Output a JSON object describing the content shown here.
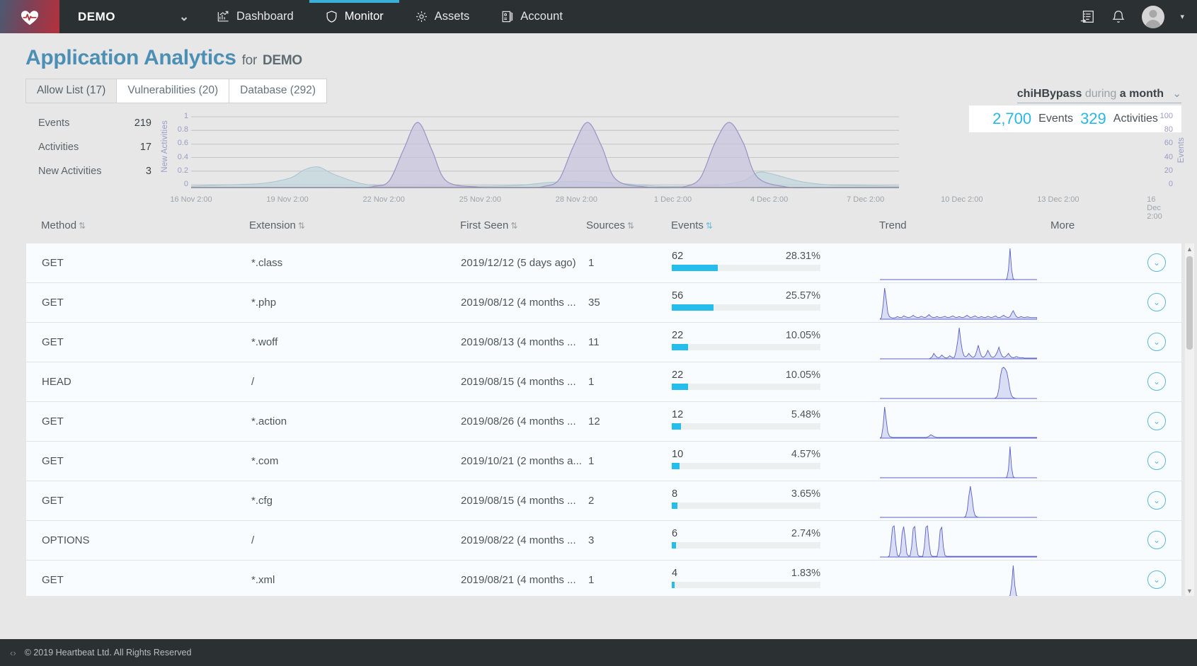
{
  "topnav": {
    "logo_icon": "heartbeat-logo-icon",
    "brand": "DEMO",
    "brand_caret": "⌄",
    "items": [
      {
        "label": "Dashboard",
        "icon": "chart-growth-icon",
        "active": false
      },
      {
        "label": "Monitor",
        "icon": "shield-icon",
        "active": true
      },
      {
        "label": "Assets",
        "icon": "gear-icon",
        "active": false
      },
      {
        "label": "Account",
        "icon": "id-card-icon",
        "active": false
      }
    ],
    "right_icons": [
      "task-list-icon",
      "bell-icon",
      "avatar"
    ],
    "avatar_caret": "▾"
  },
  "page": {
    "title": "Application Analytics",
    "title_for": "for",
    "title_demo": "DEMO"
  },
  "tabs": [
    {
      "label": "Allow List (17)",
      "active": true
    },
    {
      "label": "Vulnerabilities (20)",
      "active": false
    },
    {
      "label": "Database (292)",
      "active": false
    }
  ],
  "filter": {
    "query": "chiHBypass",
    "during": "during",
    "range": "a month",
    "caret": "⌄"
  },
  "summary": {
    "events_value": "2,700",
    "events_label": "Events",
    "activities_value": "329",
    "activities_label": "Activities"
  },
  "stats": [
    {
      "label": "Events",
      "value": "219"
    },
    {
      "label": "Activities",
      "value": "17"
    },
    {
      "label": "New Activities",
      "value": "3"
    }
  ],
  "chart_data": {
    "type": "area",
    "title": "",
    "xlabel": "",
    "ylabel": "New Activities",
    "ylabel_right": "Events",
    "ylim": [
      0,
      1
    ],
    "ylim_right": [
      0,
      100
    ],
    "yticks": [
      "1",
      "0.8",
      "0.6",
      "0.4",
      "0.2",
      "0"
    ],
    "yticks_right": [
      "100",
      "80",
      "60",
      "40",
      "20",
      "0"
    ],
    "xticks": [
      "16 Nov 2:00",
      "19 Nov 2:00",
      "22 Nov 2:00",
      "25 Nov 2:00",
      "28 Nov 2:00",
      "1 Dec 2:00",
      "4 Dec 2:00",
      "7 Dec 2:00",
      "10 Dec 2:00",
      "13 Dec 2:00",
      "16 Dec 2:00"
    ],
    "grid": true,
    "legend_position": "none",
    "series": [
      {
        "name": "New Activities",
        "color": "#9a93c4",
        "fill": "#c9c4de",
        "x": [
          0,
          4,
          8,
          12,
          16,
          20,
          24,
          26,
          28,
          30,
          32,
          34,
          36,
          40,
          44,
          48,
          50,
          52,
          54,
          56,
          58,
          60,
          64,
          68,
          70,
          72,
          74,
          76,
          78,
          80,
          84,
          88,
          92,
          96,
          100
        ],
        "values": [
          0,
          0,
          0,
          0,
          0,
          0,
          0,
          0.02,
          0.1,
          0.55,
          0.95,
          0.55,
          0.1,
          0.01,
          0,
          0,
          0.02,
          0.12,
          0.6,
          0.95,
          0.6,
          0.12,
          0.01,
          0,
          0.02,
          0.15,
          0.65,
          0.95,
          0.65,
          0.15,
          0.01,
          0,
          0,
          0,
          0
        ]
      },
      {
        "name": "Events",
        "color": "#a8c3cf",
        "fill": "#c2d7de",
        "x": [
          0,
          5,
          10,
          14,
          16,
          18,
          20,
          24,
          28,
          34,
          40,
          46,
          50,
          54,
          58,
          62,
          66,
          70,
          74,
          78,
          80,
          82,
          86,
          90,
          94,
          100
        ],
        "values": [
          2,
          4,
          6,
          14,
          26,
          30,
          20,
          6,
          2,
          2,
          2,
          3,
          7,
          9,
          8,
          5,
          2,
          2,
          3,
          10,
          22,
          20,
          9,
          4,
          3,
          2
        ]
      }
    ]
  },
  "table": {
    "columns": [
      {
        "label": "Method",
        "sort": "both"
      },
      {
        "label": "Extension",
        "sort": "both"
      },
      {
        "label": "First Seen",
        "sort": "both"
      },
      {
        "label": "Sources",
        "sort": "both"
      },
      {
        "label": "Events",
        "sort": "active"
      },
      {
        "label": "Trend",
        "sort": "none"
      },
      {
        "label": "More",
        "sort": "none"
      }
    ],
    "rows": [
      {
        "method": "GET",
        "extension": "*.class",
        "first_seen": "2019/12/12 (5 days ago)",
        "sources": "1",
        "events": "62",
        "pct": "28.31%",
        "bar": 31,
        "more_icon": "chevron-down-circle-icon"
      },
      {
        "method": "GET",
        "extension": "*.php",
        "first_seen": "2019/08/12 (4 months ...",
        "sources": "35",
        "events": "56",
        "pct": "25.57%",
        "bar": 28,
        "more_icon": "chevron-down-circle-icon"
      },
      {
        "method": "GET",
        "extension": "*.woff",
        "first_seen": "2019/08/13 (4 months ...",
        "sources": "11",
        "events": "22",
        "pct": "10.05%",
        "bar": 11,
        "more_icon": "chevron-down-circle-icon"
      },
      {
        "method": "HEAD",
        "extension": "/",
        "first_seen": "2019/08/15 (4 months ...",
        "sources": "1",
        "events": "22",
        "pct": "10.05%",
        "bar": 11,
        "more_icon": "chevron-down-circle-icon"
      },
      {
        "method": "GET",
        "extension": "*.action",
        "first_seen": "2019/08/26 (4 months ...",
        "sources": "12",
        "events": "12",
        "pct": "5.48%",
        "bar": 6,
        "more_icon": "chevron-down-circle-icon"
      },
      {
        "method": "GET",
        "extension": "*.com",
        "first_seen": "2019/10/21 (2 months a...",
        "sources": "1",
        "events": "10",
        "pct": "4.57%",
        "bar": 5,
        "more_icon": "chevron-down-circle-icon"
      },
      {
        "method": "GET",
        "extension": "*.cfg",
        "first_seen": "2019/08/15 (4 months ...",
        "sources": "2",
        "events": "8",
        "pct": "3.65%",
        "bar": 4,
        "more_icon": "chevron-down-circle-icon"
      },
      {
        "method": "OPTIONS",
        "extension": "/",
        "first_seen": "2019/08/22 (4 months ...",
        "sources": "3",
        "events": "6",
        "pct": "2.74%",
        "bar": 3,
        "more_icon": "chevron-down-circle-icon"
      },
      {
        "method": "GET",
        "extension": "*.xml",
        "first_seen": "2019/08/21 (4 months ...",
        "sources": "1",
        "events": "4",
        "pct": "1.83%",
        "bar": 2,
        "more_icon": "chevron-down-circle-icon"
      }
    ],
    "sparklines": [
      [
        0,
        0,
        0,
        0,
        0,
        0,
        0,
        0,
        0,
        0,
        0,
        0,
        0,
        0,
        0,
        0,
        0,
        0,
        0,
        0,
        0,
        0,
        0,
        0,
        0,
        0,
        0,
        0,
        0,
        0,
        0,
        0,
        0,
        0,
        0,
        0,
        0,
        0,
        0,
        0,
        0,
        0,
        0,
        0,
        0,
        0,
        0,
        0,
        0,
        0,
        0,
        0,
        0,
        0,
        0,
        0,
        0,
        0,
        0,
        0,
        0,
        0,
        0,
        0,
        0,
        0,
        0,
        0,
        0,
        0,
        0,
        0,
        0,
        0,
        0,
        0,
        0,
        0,
        0,
        0,
        2,
        30,
        95,
        30,
        2,
        0,
        0,
        0,
        0,
        0,
        0,
        0,
        0,
        0,
        0,
        0,
        0,
        0,
        0,
        0
      ],
      [
        0,
        5,
        40,
        95,
        60,
        20,
        8,
        5,
        4,
        4,
        5,
        8,
        6,
        5,
        6,
        10,
        8,
        6,
        5,
        6,
        8,
        12,
        8,
        6,
        5,
        6,
        9,
        7,
        5,
        6,
        10,
        14,
        9,
        6,
        5,
        6,
        8,
        6,
        5,
        6,
        7,
        9,
        6,
        5,
        6,
        8,
        10,
        7,
        5,
        6,
        8,
        6,
        5,
        6,
        9,
        12,
        8,
        5,
        6,
        8,
        10,
        7,
        5,
        6,
        8,
        6,
        5,
        6,
        9,
        7,
        5,
        6,
        8,
        10,
        6,
        5,
        6,
        9,
        12,
        8,
        6,
        5,
        8,
        18,
        26,
        16,
        8,
        5,
        6,
        8,
        6,
        5,
        6,
        7,
        6,
        5,
        5,
        5,
        5,
        5
      ],
      [
        0,
        0,
        0,
        0,
        0,
        0,
        0,
        0,
        0,
        0,
        0,
        0,
        0,
        0,
        0,
        0,
        0,
        0,
        0,
        0,
        0,
        0,
        0,
        0,
        0,
        0,
        0,
        0,
        0,
        0,
        0,
        0,
        2,
        6,
        14,
        8,
        4,
        3,
        5,
        10,
        6,
        3,
        2,
        4,
        8,
        5,
        3,
        4,
        20,
        45,
        80,
        45,
        20,
        8,
        5,
        8,
        14,
        9,
        5,
        4,
        8,
        20,
        35,
        18,
        7,
        4,
        6,
        12,
        22,
        14,
        6,
        4,
        5,
        10,
        18,
        30,
        16,
        7,
        4,
        5,
        9,
        14,
        8,
        4,
        3,
        4,
        6,
        4,
        3,
        3,
        3,
        2,
        2,
        2,
        2,
        2,
        2,
        2,
        2,
        2
      ],
      [
        0,
        0,
        0,
        0,
        0,
        0,
        0,
        0,
        0,
        0,
        0,
        0,
        0,
        0,
        0,
        0,
        0,
        0,
        0,
        0,
        0,
        0,
        0,
        0,
        0,
        0,
        0,
        0,
        0,
        0,
        0,
        0,
        0,
        0,
        0,
        0,
        0,
        0,
        0,
        0,
        0,
        0,
        0,
        0,
        0,
        0,
        0,
        0,
        0,
        0,
        0,
        0,
        0,
        0,
        0,
        0,
        0,
        0,
        0,
        0,
        0,
        0,
        0,
        0,
        0,
        0,
        0,
        0,
        0,
        0,
        0,
        0,
        0,
        2,
        8,
        30,
        70,
        92,
        95,
        90,
        80,
        55,
        25,
        8,
        3,
        1,
        0,
        0,
        0,
        0,
        0,
        0,
        0,
        0,
        0,
        0,
        0,
        0,
        0,
        0
      ],
      [
        0,
        4,
        35,
        95,
        55,
        18,
        6,
        3,
        2,
        2,
        2,
        2,
        2,
        2,
        2,
        2,
        2,
        2,
        2,
        2,
        2,
        2,
        2,
        2,
        2,
        2,
        2,
        2,
        2,
        2,
        3,
        6,
        10,
        8,
        5,
        3,
        2,
        2,
        2,
        2,
        2,
        2,
        2,
        2,
        2,
        2,
        2,
        2,
        2,
        2,
        2,
        2,
        2,
        2,
        2,
        2,
        2,
        2,
        2,
        2,
        2,
        2,
        2,
        2,
        2,
        2,
        2,
        2,
        2,
        2,
        2,
        2,
        2,
        2,
        2,
        2,
        2,
        2,
        2,
        2,
        2,
        2,
        2,
        2,
        2,
        2,
        2,
        2,
        2,
        2,
        2,
        2,
        2,
        2,
        2,
        2,
        2,
        2,
        2,
        2
      ],
      [
        0,
        0,
        0,
        0,
        0,
        0,
        0,
        0,
        0,
        0,
        0,
        0,
        0,
        0,
        0,
        0,
        0,
        0,
        0,
        0,
        0,
        0,
        0,
        0,
        0,
        0,
        0,
        0,
        0,
        0,
        0,
        0,
        0,
        0,
        0,
        0,
        0,
        0,
        0,
        0,
        0,
        0,
        0,
        0,
        0,
        0,
        0,
        0,
        0,
        0,
        0,
        0,
        0,
        0,
        0,
        0,
        0,
        0,
        0,
        0,
        0,
        0,
        0,
        0,
        0,
        0,
        0,
        0,
        0,
        0,
        0,
        0,
        0,
        0,
        0,
        0,
        0,
        0,
        0,
        0,
        2,
        25,
        95,
        30,
        3,
        0,
        0,
        0,
        0,
        0,
        0,
        0,
        0,
        0,
        0,
        0,
        0,
        0,
        0,
        0
      ],
      [
        0,
        0,
        0,
        0,
        0,
        0,
        0,
        0,
        0,
        0,
        0,
        0,
        0,
        0,
        0,
        0,
        0,
        0,
        0,
        0,
        0,
        0,
        0,
        0,
        0,
        0,
        0,
        0,
        0,
        0,
        0,
        0,
        0,
        0,
        0,
        0,
        0,
        0,
        0,
        0,
        0,
        0,
        0,
        0,
        0,
        0,
        0,
        0,
        0,
        0,
        0,
        0,
        0,
        0,
        3,
        20,
        60,
        90,
        60,
        22,
        5,
        2,
        0,
        0,
        0,
        0,
        0,
        0,
        0,
        0,
        0,
        0,
        0,
        0,
        0,
        0,
        0,
        0,
        0,
        0,
        0,
        0,
        0,
        0,
        0,
        0,
        0,
        0,
        0,
        0,
        0,
        0,
        0,
        0,
        0,
        0,
        0,
        0,
        0,
        0
      ],
      [
        0,
        0,
        0,
        0,
        0,
        0,
        4,
        40,
        88,
        92,
        40,
        6,
        2,
        14,
        70,
        90,
        55,
        10,
        3,
        3,
        30,
        85,
        90,
        35,
        6,
        2,
        2,
        2,
        30,
        88,
        92,
        40,
        8,
        2,
        2,
        2,
        2,
        25,
        80,
        88,
        30,
        5,
        2,
        2,
        2,
        2,
        2,
        2,
        2,
        2,
        2,
        2,
        2,
        2,
        2,
        2,
        2,
        2,
        2,
        2,
        2,
        2,
        2,
        2,
        2,
        2,
        2,
        2,
        2,
        2,
        2,
        2,
        2,
        2,
        2,
        2,
        2,
        2,
        2,
        2,
        2,
        2,
        2,
        2,
        2,
        2,
        2,
        2,
        2,
        2,
        2,
        2,
        2,
        2,
        2,
        2,
        2,
        2,
        2,
        2
      ],
      [
        0,
        0,
        0,
        0,
        0,
        0,
        0,
        0,
        0,
        0,
        0,
        0,
        0,
        0,
        0,
        0,
        0,
        0,
        0,
        0,
        0,
        0,
        0,
        0,
        0,
        0,
        0,
        0,
        0,
        0,
        0,
        0,
        0,
        0,
        0,
        0,
        0,
        0,
        0,
        0,
        0,
        0,
        0,
        0,
        0,
        0,
        0,
        0,
        0,
        0,
        0,
        0,
        0,
        0,
        0,
        0,
        0,
        0,
        0,
        0,
        0,
        0,
        0,
        0,
        0,
        0,
        0,
        0,
        0,
        0,
        0,
        0,
        0,
        0,
        0,
        0,
        0,
        0,
        0,
        0,
        0,
        0,
        3,
        35,
        95,
        35,
        4,
        0,
        0,
        0,
        0,
        0,
        0,
        0,
        0,
        0,
        0,
        0,
        0,
        0
      ]
    ],
    "more_glyph": "⌄"
  },
  "scrollbar": {
    "up": "▲",
    "down": "▼"
  },
  "footer": {
    "mark": "‹›",
    "copyright": "© 2019 Heartbeat Ltd. All Rights Reserved"
  },
  "colors": {
    "accent": "#2bb7e4",
    "title": "#4c8fb5",
    "navbar": "#2b3033",
    "activity_line": "#9a93c4",
    "events_line": "#a8c3cf"
  }
}
